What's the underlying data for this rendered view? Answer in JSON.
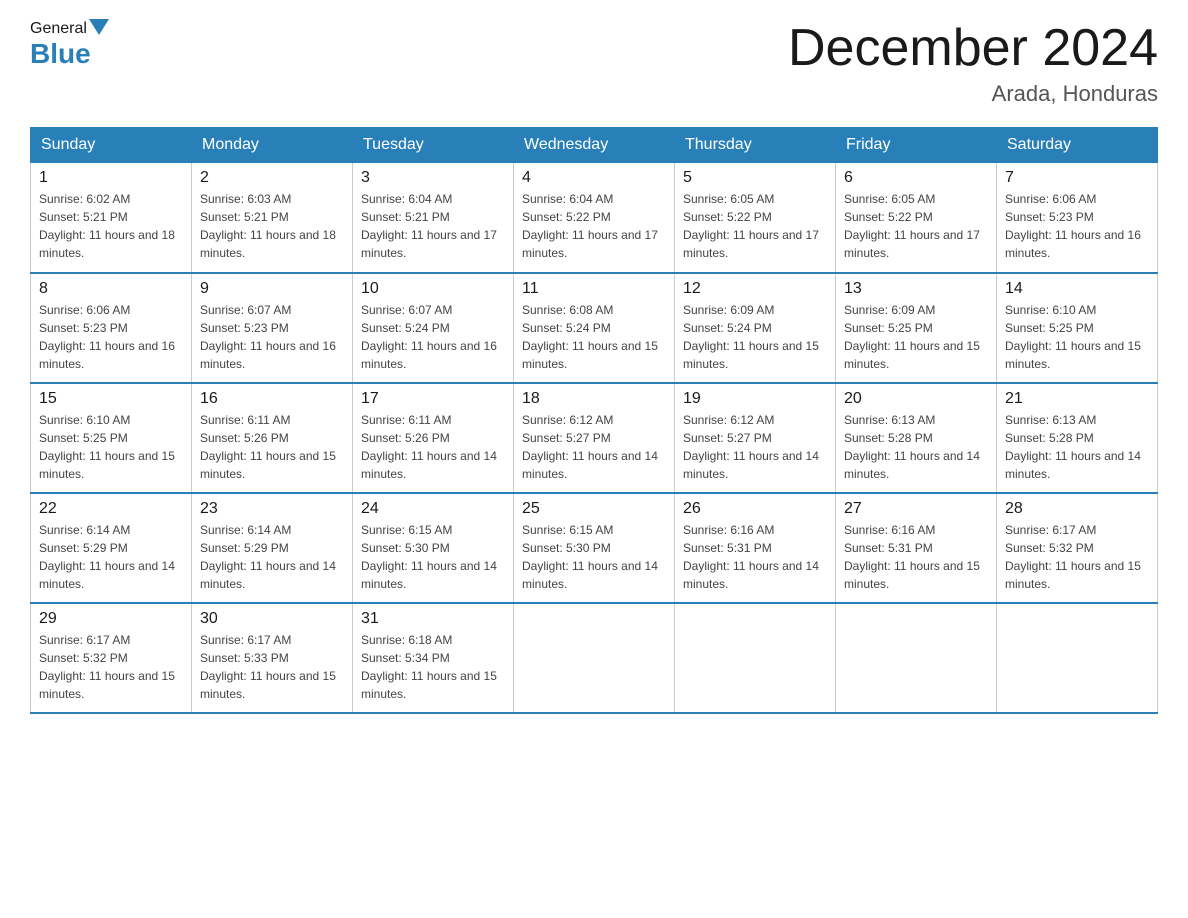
{
  "header": {
    "logo_general": "General",
    "logo_blue": "Blue",
    "month_title": "December 2024",
    "location": "Arada, Honduras"
  },
  "weekdays": [
    "Sunday",
    "Monday",
    "Tuesday",
    "Wednesday",
    "Thursday",
    "Friday",
    "Saturday"
  ],
  "weeks": [
    [
      {
        "day": "1",
        "sunrise": "6:02 AM",
        "sunset": "5:21 PM",
        "daylight": "11 hours and 18 minutes."
      },
      {
        "day": "2",
        "sunrise": "6:03 AM",
        "sunset": "5:21 PM",
        "daylight": "11 hours and 18 minutes."
      },
      {
        "day": "3",
        "sunrise": "6:04 AM",
        "sunset": "5:21 PM",
        "daylight": "11 hours and 17 minutes."
      },
      {
        "day": "4",
        "sunrise": "6:04 AM",
        "sunset": "5:22 PM",
        "daylight": "11 hours and 17 minutes."
      },
      {
        "day": "5",
        "sunrise": "6:05 AM",
        "sunset": "5:22 PM",
        "daylight": "11 hours and 17 minutes."
      },
      {
        "day": "6",
        "sunrise": "6:05 AM",
        "sunset": "5:22 PM",
        "daylight": "11 hours and 17 minutes."
      },
      {
        "day": "7",
        "sunrise": "6:06 AM",
        "sunset": "5:23 PM",
        "daylight": "11 hours and 16 minutes."
      }
    ],
    [
      {
        "day": "8",
        "sunrise": "6:06 AM",
        "sunset": "5:23 PM",
        "daylight": "11 hours and 16 minutes."
      },
      {
        "day": "9",
        "sunrise": "6:07 AM",
        "sunset": "5:23 PM",
        "daylight": "11 hours and 16 minutes."
      },
      {
        "day": "10",
        "sunrise": "6:07 AM",
        "sunset": "5:24 PM",
        "daylight": "11 hours and 16 minutes."
      },
      {
        "day": "11",
        "sunrise": "6:08 AM",
        "sunset": "5:24 PM",
        "daylight": "11 hours and 15 minutes."
      },
      {
        "day": "12",
        "sunrise": "6:09 AM",
        "sunset": "5:24 PM",
        "daylight": "11 hours and 15 minutes."
      },
      {
        "day": "13",
        "sunrise": "6:09 AM",
        "sunset": "5:25 PM",
        "daylight": "11 hours and 15 minutes."
      },
      {
        "day": "14",
        "sunrise": "6:10 AM",
        "sunset": "5:25 PM",
        "daylight": "11 hours and 15 minutes."
      }
    ],
    [
      {
        "day": "15",
        "sunrise": "6:10 AM",
        "sunset": "5:25 PM",
        "daylight": "11 hours and 15 minutes."
      },
      {
        "day": "16",
        "sunrise": "6:11 AM",
        "sunset": "5:26 PM",
        "daylight": "11 hours and 15 minutes."
      },
      {
        "day": "17",
        "sunrise": "6:11 AM",
        "sunset": "5:26 PM",
        "daylight": "11 hours and 14 minutes."
      },
      {
        "day": "18",
        "sunrise": "6:12 AM",
        "sunset": "5:27 PM",
        "daylight": "11 hours and 14 minutes."
      },
      {
        "day": "19",
        "sunrise": "6:12 AM",
        "sunset": "5:27 PM",
        "daylight": "11 hours and 14 minutes."
      },
      {
        "day": "20",
        "sunrise": "6:13 AM",
        "sunset": "5:28 PM",
        "daylight": "11 hours and 14 minutes."
      },
      {
        "day": "21",
        "sunrise": "6:13 AM",
        "sunset": "5:28 PM",
        "daylight": "11 hours and 14 minutes."
      }
    ],
    [
      {
        "day": "22",
        "sunrise": "6:14 AM",
        "sunset": "5:29 PM",
        "daylight": "11 hours and 14 minutes."
      },
      {
        "day": "23",
        "sunrise": "6:14 AM",
        "sunset": "5:29 PM",
        "daylight": "11 hours and 14 minutes."
      },
      {
        "day": "24",
        "sunrise": "6:15 AM",
        "sunset": "5:30 PM",
        "daylight": "11 hours and 14 minutes."
      },
      {
        "day": "25",
        "sunrise": "6:15 AM",
        "sunset": "5:30 PM",
        "daylight": "11 hours and 14 minutes."
      },
      {
        "day": "26",
        "sunrise": "6:16 AM",
        "sunset": "5:31 PM",
        "daylight": "11 hours and 14 minutes."
      },
      {
        "day": "27",
        "sunrise": "6:16 AM",
        "sunset": "5:31 PM",
        "daylight": "11 hours and 15 minutes."
      },
      {
        "day": "28",
        "sunrise": "6:17 AM",
        "sunset": "5:32 PM",
        "daylight": "11 hours and 15 minutes."
      }
    ],
    [
      {
        "day": "29",
        "sunrise": "6:17 AM",
        "sunset": "5:32 PM",
        "daylight": "11 hours and 15 minutes."
      },
      {
        "day": "30",
        "sunrise": "6:17 AM",
        "sunset": "5:33 PM",
        "daylight": "11 hours and 15 minutes."
      },
      {
        "day": "31",
        "sunrise": "6:18 AM",
        "sunset": "5:34 PM",
        "daylight": "11 hours and 15 minutes."
      },
      null,
      null,
      null,
      null
    ]
  ]
}
